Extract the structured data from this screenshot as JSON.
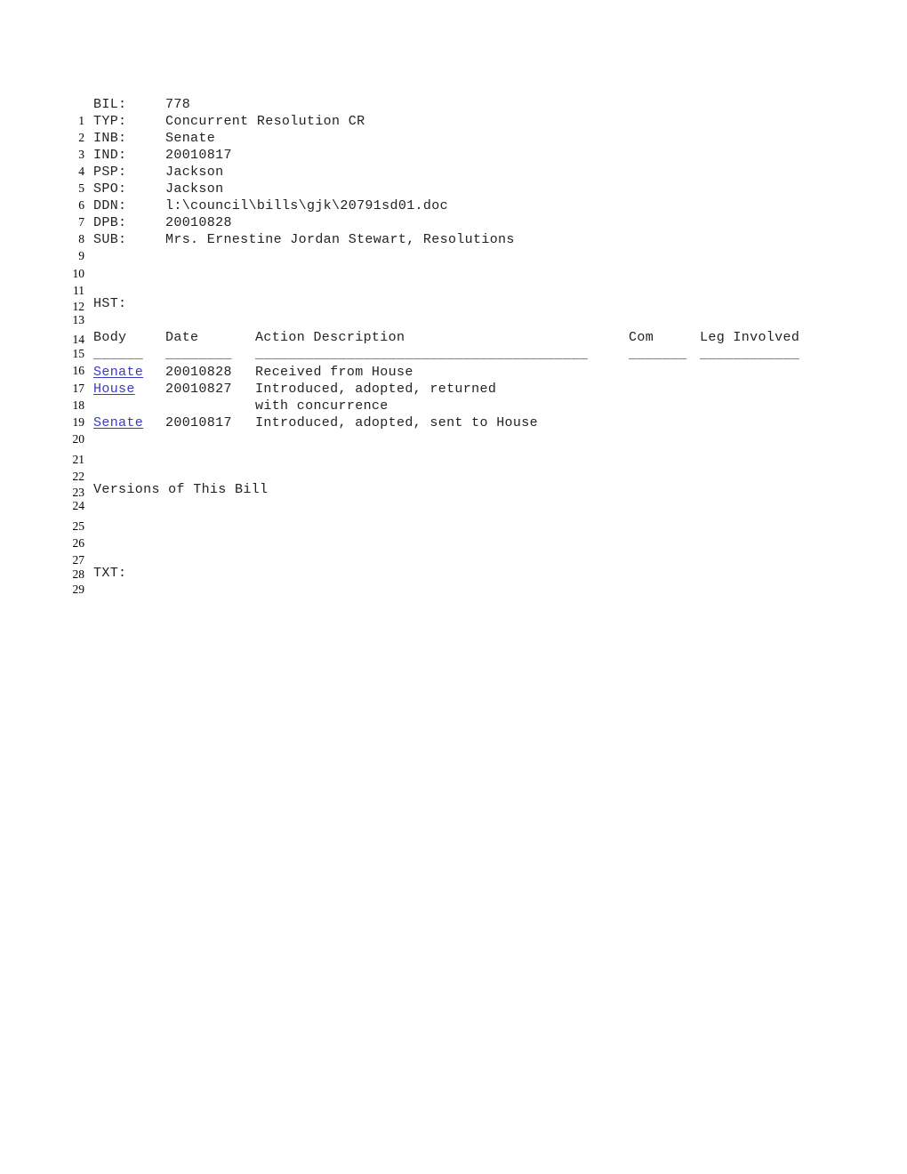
{
  "document": {
    "type": "legislative-bill-record",
    "fields": [
      {
        "line": 1,
        "label": "BIL:",
        "value": "778"
      },
      {
        "line": 2,
        "label": "TYP:",
        "value": "Concurrent Resolution CR"
      },
      {
        "line": 3,
        "label": "INB:",
        "value": "Senate"
      },
      {
        "line": 4,
        "label": "IND:",
        "value": "20010817"
      },
      {
        "line": 5,
        "label": "PSP:",
        "value": "Jackson"
      },
      {
        "line": 6,
        "label": "SPO:",
        "value": "Jackson"
      },
      {
        "line": 7,
        "label": "DDN:",
        "value": "l:\\council\\bills\\gjk\\20791sd01.doc"
      },
      {
        "line": 8,
        "label": "DPB:",
        "value": "20010828"
      },
      {
        "line": 9,
        "label": "SUB:",
        "value": "Mrs. Ernestine Jordan Stewart, Resolutions"
      }
    ],
    "history_label": "HST:",
    "history_table": {
      "headers": {
        "body": "Body",
        "date": "Date",
        "action": "Action Description",
        "com": "Com",
        "leg": "Leg Involved"
      },
      "separators": {
        "body": "______",
        "date": "________",
        "action": "________________________________________",
        "com": "_______",
        "leg": "____________"
      },
      "rows": [
        {
          "line": 17,
          "body": "Senate",
          "body_is_link": true,
          "date": "20010828",
          "action": "Received from House",
          "com": "",
          "leg": ""
        },
        {
          "line": 18,
          "body": "House",
          "body_is_link": true,
          "date": "20010827",
          "action": "Introduced, adopted, returned",
          "com": "",
          "leg": ""
        },
        {
          "line": 19,
          "body": "",
          "body_is_link": false,
          "date": "",
          "action": "with concurrence",
          "com": "",
          "leg": ""
        },
        {
          "line": 20,
          "body": "Senate",
          "body_is_link": true,
          "date": "20010817",
          "action": "Introduced, adopted, sent to House",
          "com": "",
          "leg": ""
        }
      ]
    },
    "versions_heading": "Versions of This Bill",
    "text_label": "TXT:",
    "blank_lines": [
      10,
      11,
      12,
      14,
      16,
      21,
      22,
      23,
      25,
      26,
      27,
      28
    ],
    "line_numbers": [
      1,
      2,
      3,
      4,
      5,
      6,
      7,
      8,
      9,
      10,
      11,
      12,
      13,
      14,
      15,
      16,
      17,
      18,
      19,
      20,
      21,
      22,
      23,
      24,
      25,
      26,
      27,
      28,
      29
    ]
  },
  "colors": {
    "link": "#3a3ac0",
    "text": "#222222",
    "lineno": "#000000",
    "background": "#ffffff"
  }
}
